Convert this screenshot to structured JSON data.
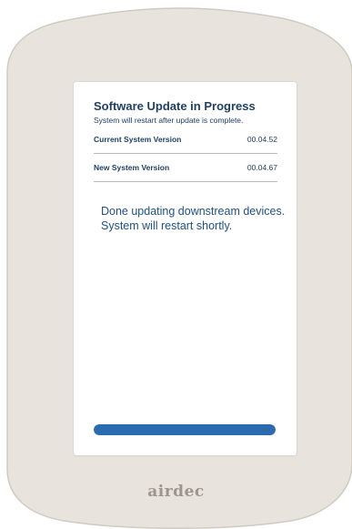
{
  "update": {
    "title": "Software Update in Progress",
    "subtitle": "System will restart after update is complete.",
    "rows": [
      {
        "label": "Current System Version",
        "value": "00.04.52"
      },
      {
        "label": "New System Version",
        "value": "00.04.67"
      }
    ],
    "status_lines": [
      "Done updating downstream devices.",
      "System will restart shortly."
    ],
    "progress": 1.0
  },
  "device": {
    "brand": "airdec",
    "colors": {
      "bezel": "#e8e4dd",
      "bezel_edge": "#cfcac2",
      "accent": "#2b6cb0",
      "text": "#1f3f66"
    }
  }
}
